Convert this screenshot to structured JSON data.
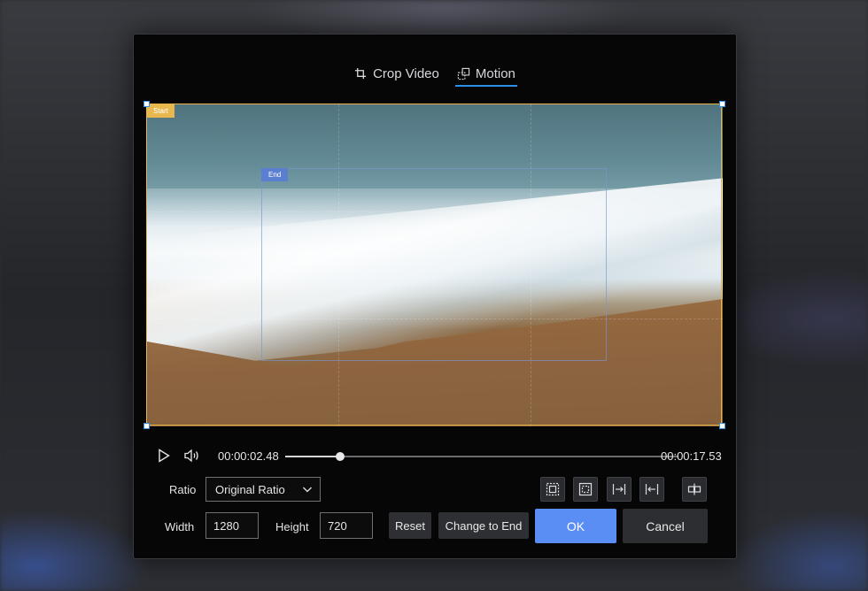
{
  "tabs": [
    {
      "label": "Crop Video",
      "icon": "crop-icon",
      "active": false
    },
    {
      "label": "Motion",
      "icon": "motion-icon",
      "active": true
    }
  ],
  "preview": {
    "start_label": "Start",
    "end_label": "End"
  },
  "player": {
    "current_time": "00:00:02.48",
    "total_time": "00:00:17.53",
    "progress_fraction": 0.14
  },
  "controls": {
    "ratio_label": "Ratio",
    "ratio_value": "Original Ratio",
    "width_label": "Width",
    "width_value": "1280",
    "height_label": "Height",
    "height_value": "720",
    "reset_label": "Reset",
    "change_to_end_label": "Change to End",
    "ok_label": "OK",
    "cancel_label": "Cancel"
  },
  "tool_icons": [
    "fit-crop-icon",
    "fill-frame-icon",
    "align-right-icon",
    "align-left-icon",
    "swap-icon"
  ],
  "colors": {
    "accent": "#2e8fe6",
    "ok_button": "#5b8ef5",
    "start_frame": "#e6b548",
    "end_frame": "#5b7fd0"
  }
}
